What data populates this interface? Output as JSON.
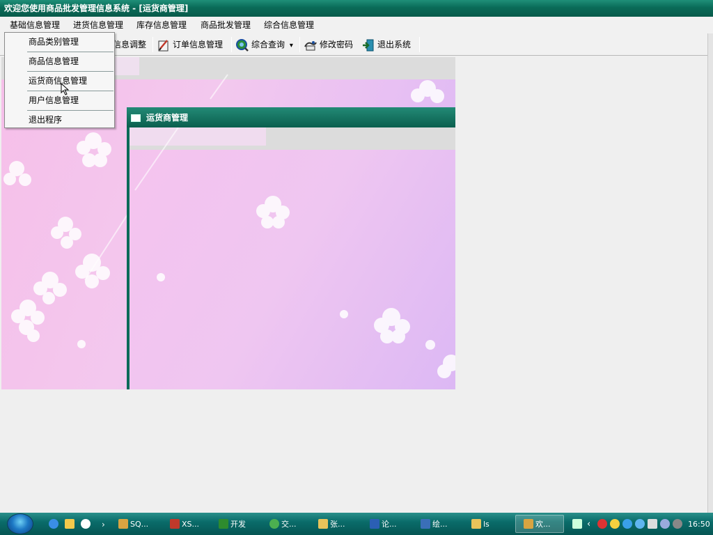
{
  "window": {
    "title": "欢迎您使用商品批发管理信息系统 - [运货商管理]"
  },
  "menu": {
    "items": [
      {
        "label": "基础信息管理"
      },
      {
        "label": "进货信息管理"
      },
      {
        "label": "库存信息管理"
      },
      {
        "label": "商品批发管理"
      },
      {
        "label": "综合信息管理"
      }
    ]
  },
  "toolbar": {
    "items": [
      {
        "label": "信息调整",
        "icon": "adjust-icon"
      },
      {
        "label": "订单信息管理",
        "icon": "order-icon"
      },
      {
        "label": "综合查询",
        "icon": "query-icon"
      },
      {
        "label": "修改密码",
        "icon": "password-icon"
      },
      {
        "label": "退出系统",
        "icon": "exit-icon"
      }
    ],
    "query_arrow": "▾"
  },
  "dropdown": {
    "items": [
      {
        "label": "商品类别管理"
      },
      {
        "label": "商品信息管理"
      },
      {
        "label": "运货商信息管理"
      },
      {
        "label": "用户信息管理"
      },
      {
        "label": "退出程序"
      }
    ]
  },
  "child_window": {
    "title": "运货商管理"
  },
  "taskbar": {
    "items": [
      {
        "label": "SQ...",
        "color": "#d9a441"
      },
      {
        "label": "XS...",
        "color": "#c0392b"
      },
      {
        "label": "开发",
        "color": "#2e8b2e"
      },
      {
        "label": "交...",
        "color": "#4caf50"
      },
      {
        "label": "张...",
        "color": "#e8c35a"
      },
      {
        "label": "论...",
        "color": "#2b5fb4"
      },
      {
        "label": "绘...",
        "color": "#3a6fb8"
      },
      {
        "label": "ls",
        "color": "#e8c35a"
      },
      {
        "label": "欢...",
        "color": "#d9a441"
      }
    ],
    "clock": "16:50"
  },
  "colors": {
    "titlebar": "#0a6b58",
    "accent": "#0b6b58",
    "background": "#efefef"
  }
}
